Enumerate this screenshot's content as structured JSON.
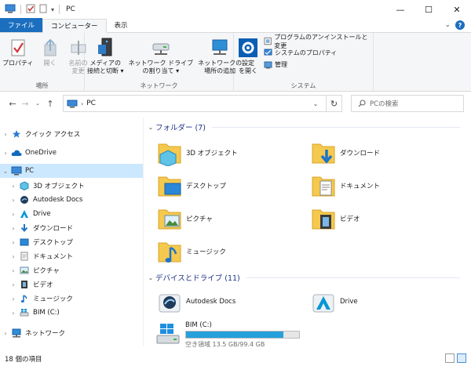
{
  "window": {
    "title": "PC",
    "minimize": "—",
    "maximize": "☐",
    "close": "✕"
  },
  "tabs": {
    "file": "ファイル",
    "computer": "コンピューター",
    "view": "表示"
  },
  "ribbon": {
    "location": {
      "label": "場所",
      "properties": "プロパティ",
      "open": "開く",
      "rename": "名前の\n変更"
    },
    "network": {
      "label": "ネットワーク",
      "media": "メディアの\n接続と切断 ▾",
      "map_drive": "ネットワーク ドライブ\nの割り当て ▾",
      "add_location": "ネットワークの\n場所の追加"
    },
    "system": {
      "label": "システム",
      "open_settings": "設定\nを開く",
      "uninstall": "プログラムのアンインストールと変更",
      "sys_props": "システムのプロパティ",
      "manage": "管理"
    }
  },
  "address": {
    "path": "PC",
    "search_placeholder": "PCの検索"
  },
  "nav": {
    "quick_access": "クイック アクセス",
    "onedrive": "OneDrive",
    "pc": "PC",
    "children": [
      "3D オブジェクト",
      "Autodesk Docs",
      "Drive",
      "ダウンロード",
      "デスクトップ",
      "ドキュメント",
      "ピクチャ",
      "ビデオ",
      "ミュージック",
      "BIM  (C:)"
    ],
    "network": "ネットワーク"
  },
  "content": {
    "folders_header": "フォルダー (7)",
    "folders": [
      "3D オブジェクト",
      "ダウンロード",
      "デスクトップ",
      "ドキュメント",
      "ピクチャ",
      "ビデオ",
      "ミュージック"
    ],
    "devices_header": "デバイスとドライブ (11)",
    "devices": [
      "Autodesk Docs",
      "Drive"
    ],
    "drive": {
      "name": "BIM  (C:)",
      "free_text": "空き領域 13.5 GB/99.4 GB",
      "used_fraction": 0.864
    }
  },
  "status": {
    "count": "18 個の項目"
  },
  "colors": {
    "accent": "#1c6fbf",
    "folder": "#f4c94e",
    "selection": "#cce8ff",
    "group_header": "#1e3287"
  }
}
